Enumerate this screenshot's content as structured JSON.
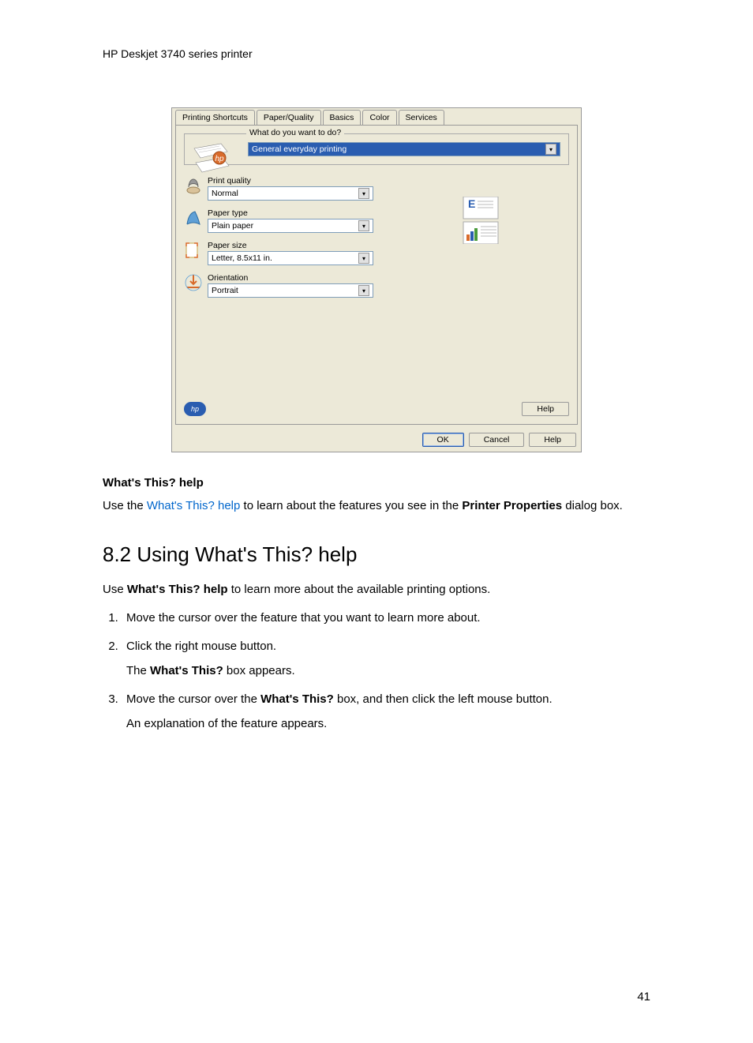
{
  "header": "HP Deskjet 3740 series printer",
  "dialog": {
    "tabs": [
      "Printing Shortcuts",
      "Paper/Quality",
      "Basics",
      "Color",
      "Services"
    ],
    "active_tab_index": 0,
    "fieldset_legend": "What do you want to do?",
    "task_value": "General everyday printing",
    "options": {
      "print_quality": {
        "label": "Print quality",
        "value": "Normal"
      },
      "paper_type": {
        "label": "Paper type",
        "value": "Plain paper"
      },
      "paper_size": {
        "label": "Paper size",
        "value": "Letter, 8.5x11 in."
      },
      "orientation": {
        "label": "Orientation",
        "value": "Portrait"
      }
    },
    "help_button": "Help",
    "buttons": {
      "ok": "OK",
      "cancel": "Cancel",
      "help": "Help"
    },
    "hp_logo_text": "hp"
  },
  "section1": {
    "heading": "What's This? help",
    "text_prefix": "Use the ",
    "text_link": "What's This? help",
    "text_mid": " to learn about the features you see in the ",
    "text_bold": "Printer Properties",
    "text_suffix": " dialog box."
  },
  "section2": {
    "heading": "8.2  Using What's This? help",
    "intro_prefix": "Use ",
    "intro_bold": "What's This? help",
    "intro_suffix": " to learn more about the available printing options.",
    "steps": {
      "s1": "Move the cursor over the feature that you want to learn more about.",
      "s2": "Click the right mouse button.",
      "s2_sub_prefix": "The ",
      "s2_sub_bold": "What's This?",
      "s2_sub_suffix": " box appears.",
      "s3_prefix": "Move the cursor over the ",
      "s3_bold": "What's This?",
      "s3_suffix": " box, and then click the left mouse button.",
      "s3_sub": "An explanation of the feature appears."
    }
  },
  "page_number": "41"
}
